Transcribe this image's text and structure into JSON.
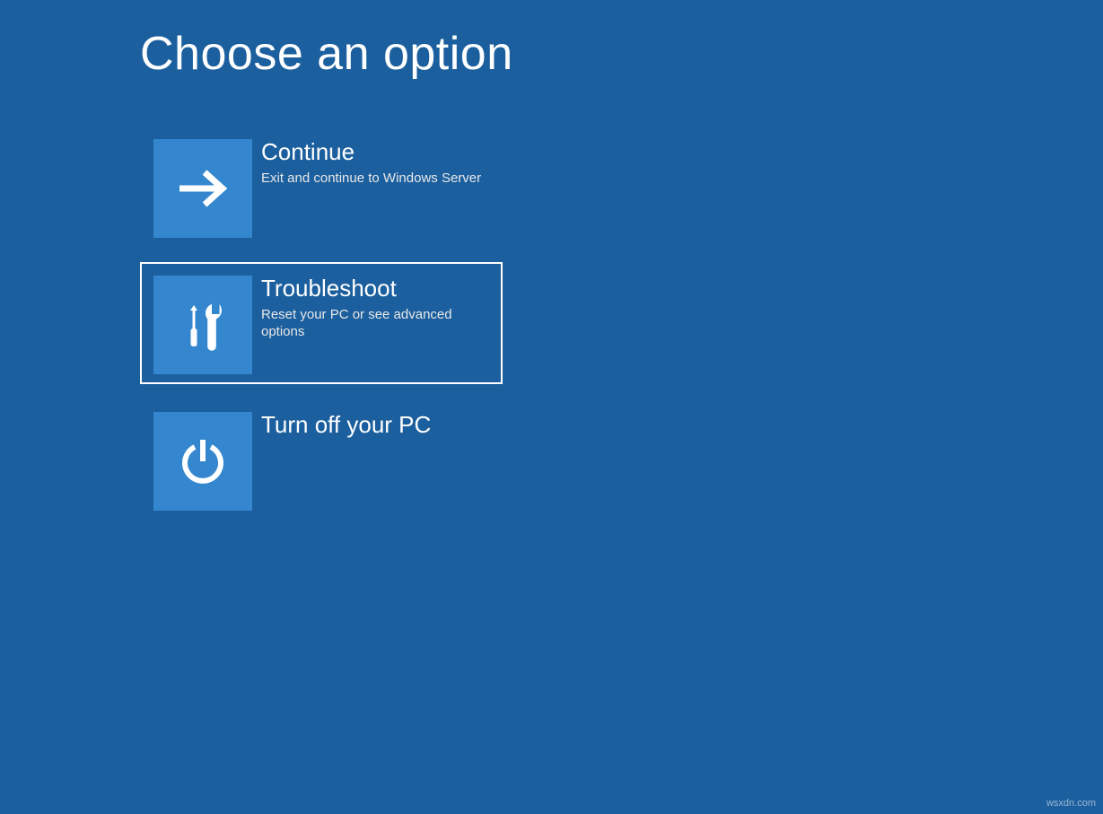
{
  "page_title": "Choose an option",
  "options": [
    {
      "id": "continue",
      "title": "Continue",
      "description": "Exit and continue to Windows Server",
      "icon": "arrow-right-icon",
      "selected": false
    },
    {
      "id": "troubleshoot",
      "title": "Troubleshoot",
      "description": "Reset your PC or see advanced options",
      "icon": "tools-icon",
      "selected": true
    },
    {
      "id": "turn-off",
      "title": "Turn off your PC",
      "description": "",
      "icon": "power-icon",
      "selected": false
    }
  ],
  "colors": {
    "background": "#1b5f9e",
    "tile_icon_bg": "#3487cf",
    "text": "#ffffff"
  },
  "watermark": "wsxdn.com"
}
